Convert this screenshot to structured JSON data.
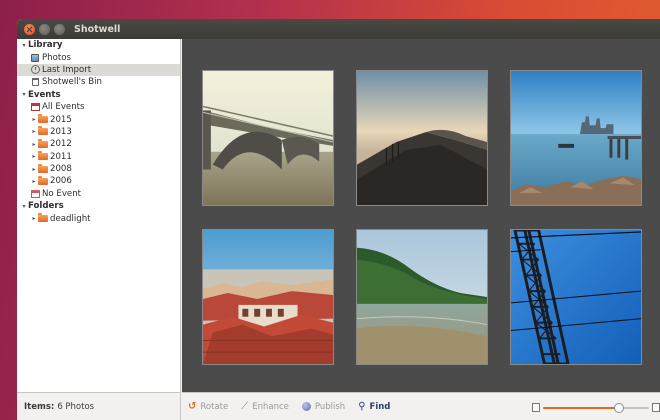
{
  "window": {
    "title": "Shotwell"
  },
  "sidebar": {
    "items": [
      {
        "label": "Library",
        "level": 0,
        "kind": "header",
        "icon": "",
        "expander": "open"
      },
      {
        "label": "Photos",
        "level": 1,
        "kind": "item",
        "icon": "photos-icon"
      },
      {
        "label": "Last Import",
        "level": 1,
        "kind": "item",
        "icon": "clock-icon",
        "selected": true
      },
      {
        "label": "Shotwell's Bin",
        "level": 1,
        "kind": "item",
        "icon": "trash-icon"
      },
      {
        "label": "Events",
        "level": 0,
        "kind": "header",
        "icon": "",
        "expander": "open"
      },
      {
        "label": "All Events",
        "level": 1,
        "kind": "item",
        "icon": "events-icon"
      },
      {
        "label": "2015",
        "level": 1,
        "kind": "item",
        "icon": "folder-icon",
        "expander": "closed"
      },
      {
        "label": "2013",
        "level": 1,
        "kind": "item",
        "icon": "folder-icon",
        "expander": "closed"
      },
      {
        "label": "2012",
        "level": 1,
        "kind": "item",
        "icon": "folder-icon",
        "expander": "closed"
      },
      {
        "label": "2011",
        "level": 1,
        "kind": "item",
        "icon": "folder-icon",
        "expander": "closed"
      },
      {
        "label": "2008",
        "level": 1,
        "kind": "item",
        "icon": "folder-icon",
        "expander": "closed"
      },
      {
        "label": "2006",
        "level": 1,
        "kind": "item",
        "icon": "folder-icon",
        "expander": "closed"
      },
      {
        "label": "No Event",
        "level": 1,
        "kind": "item",
        "icon": "noevent-icon"
      },
      {
        "label": "Folders",
        "level": 0,
        "kind": "header",
        "icon": "",
        "expander": "open"
      },
      {
        "label": "deadlight",
        "level": 1,
        "kind": "item",
        "icon": "folder-icon",
        "expander": "closed"
      }
    ],
    "footer": {
      "label": "Items:",
      "value": "6 Photos"
    }
  },
  "photos": [
    {
      "name": "bridge-photo"
    },
    {
      "name": "dunes-photo"
    },
    {
      "name": "skyline-photo"
    },
    {
      "name": "rooftops-photo"
    },
    {
      "name": "coast-photo"
    },
    {
      "name": "pylon-photo"
    }
  ],
  "toolbar": {
    "rotate": "Rotate",
    "enhance": "Enhance",
    "publish": "Publish",
    "find": "Find",
    "zoom_level": 0.72
  },
  "colors": {
    "accent": "#e06a20",
    "viewer_bg": "#4b4b4b",
    "selected_row": "#dcdad5"
  }
}
